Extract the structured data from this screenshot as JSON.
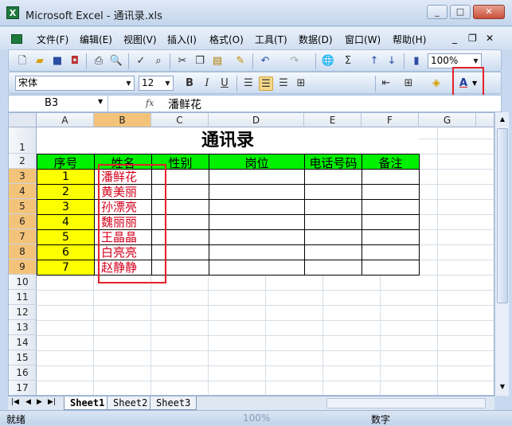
{
  "window": {
    "title": "Microsoft Excel - 通讯录.xls",
    "min": "_",
    "max": "□",
    "close": "✕"
  },
  "menu": [
    "文件(F)",
    "编辑(E)",
    "视图(V)",
    "插入(I)",
    "格式(O)",
    "工具(T)",
    "数据(D)",
    "窗口(W)",
    "帮助(H)"
  ],
  "menu_right": {
    "min": "_",
    "restore": "❐",
    "close": "✕"
  },
  "toolbar": {
    "zoom": "100%"
  },
  "format_toolbar": {
    "font": "宋体",
    "size": "12",
    "bold": "B",
    "italic": "I",
    "underline": "U",
    "font_color_glyph": "A"
  },
  "formula_bar": {
    "name_box": "B3",
    "fx": "fx",
    "content": "潘鲜花"
  },
  "columns": [
    "A",
    "B",
    "C",
    "D",
    "E",
    "F",
    "G"
  ],
  "rows": [
    "1",
    "2",
    "3",
    "4",
    "5",
    "6",
    "7",
    "8",
    "9",
    "10",
    "11",
    "12",
    "13",
    "14",
    "15",
    "16",
    "17"
  ],
  "sheet": {
    "title": "通讯录",
    "headers": [
      "序号",
      "姓名",
      "性别",
      "岗位",
      "电话号码",
      "备注"
    ],
    "records": [
      {
        "no": "1",
        "name": "潘鲜花"
      },
      {
        "no": "2",
        "name": "黄美丽"
      },
      {
        "no": "3",
        "name": "孙漂亮"
      },
      {
        "no": "4",
        "name": "魏丽丽"
      },
      {
        "no": "5",
        "name": "王晶晶"
      },
      {
        "no": "6",
        "name": "白亮亮"
      },
      {
        "no": "7",
        "name": "赵静静"
      }
    ]
  },
  "sheet_tabs": [
    "Sheet1",
    "Sheet2",
    "Sheet3"
  ],
  "status": {
    "ready": "就绪",
    "mode": "数字",
    "zoom": "100%"
  },
  "colors": {
    "header_green": "#00f000",
    "number_yellow": "#fbff00",
    "name_red": "#d4001c",
    "highlight_red": "#e4222a"
  }
}
